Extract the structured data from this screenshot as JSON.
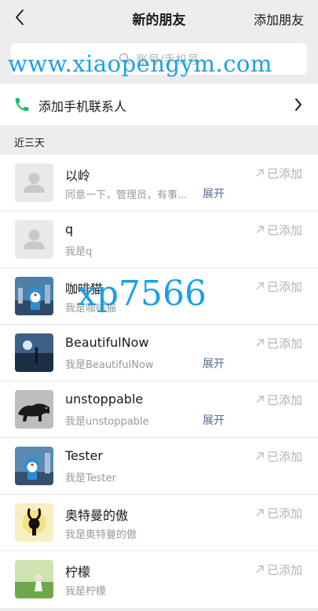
{
  "navbar": {
    "title": "新的朋友",
    "action": "添加朋友"
  },
  "search": {
    "placeholder": "账号/手机号"
  },
  "add_phone": {
    "label": "添加手机联系人"
  },
  "section": {
    "label": "近三天"
  },
  "watermarks": {
    "site": "www.xiaopengym.com",
    "code": "xp7566"
  },
  "status_label": "已添加",
  "expand_label": "展开",
  "friends": [
    {
      "name": "以岭",
      "message": "同意一下，管理员，有事...",
      "expand": true,
      "avatar": "default-avatar"
    },
    {
      "name": "q",
      "message": "我是q",
      "expand": false,
      "avatar": "default-avatar"
    },
    {
      "name": "咖啡猫",
      "message": "我是咖啡猫",
      "expand": false,
      "avatar": "doraemon-city-avatar"
    },
    {
      "name": "BeautifulNow",
      "message": "我是BeautifulNow",
      "expand": true,
      "avatar": "sky-silhouette-avatar"
    },
    {
      "name": "unstoppable",
      "message": "我是unstoppable",
      "expand": true,
      "avatar": "panther-avatar"
    },
    {
      "name": "Tester",
      "message": "我是Tester",
      "expand": false,
      "avatar": "doraemon-city-avatar"
    },
    {
      "name": "奥特曼的傲",
      "message": "我是奥特曼的傲",
      "expand": false,
      "avatar": "bunny-silhouette-avatar"
    },
    {
      "name": "柠檬",
      "message": "我是柠檬",
      "expand": false,
      "avatar": "meadow-girl-avatar"
    }
  ],
  "colors": {
    "background": "#ededed",
    "link": "#576b95",
    "phone_green": "#07c160",
    "watermark": "#1aa0e8",
    "muted": "#b2b2b2"
  }
}
